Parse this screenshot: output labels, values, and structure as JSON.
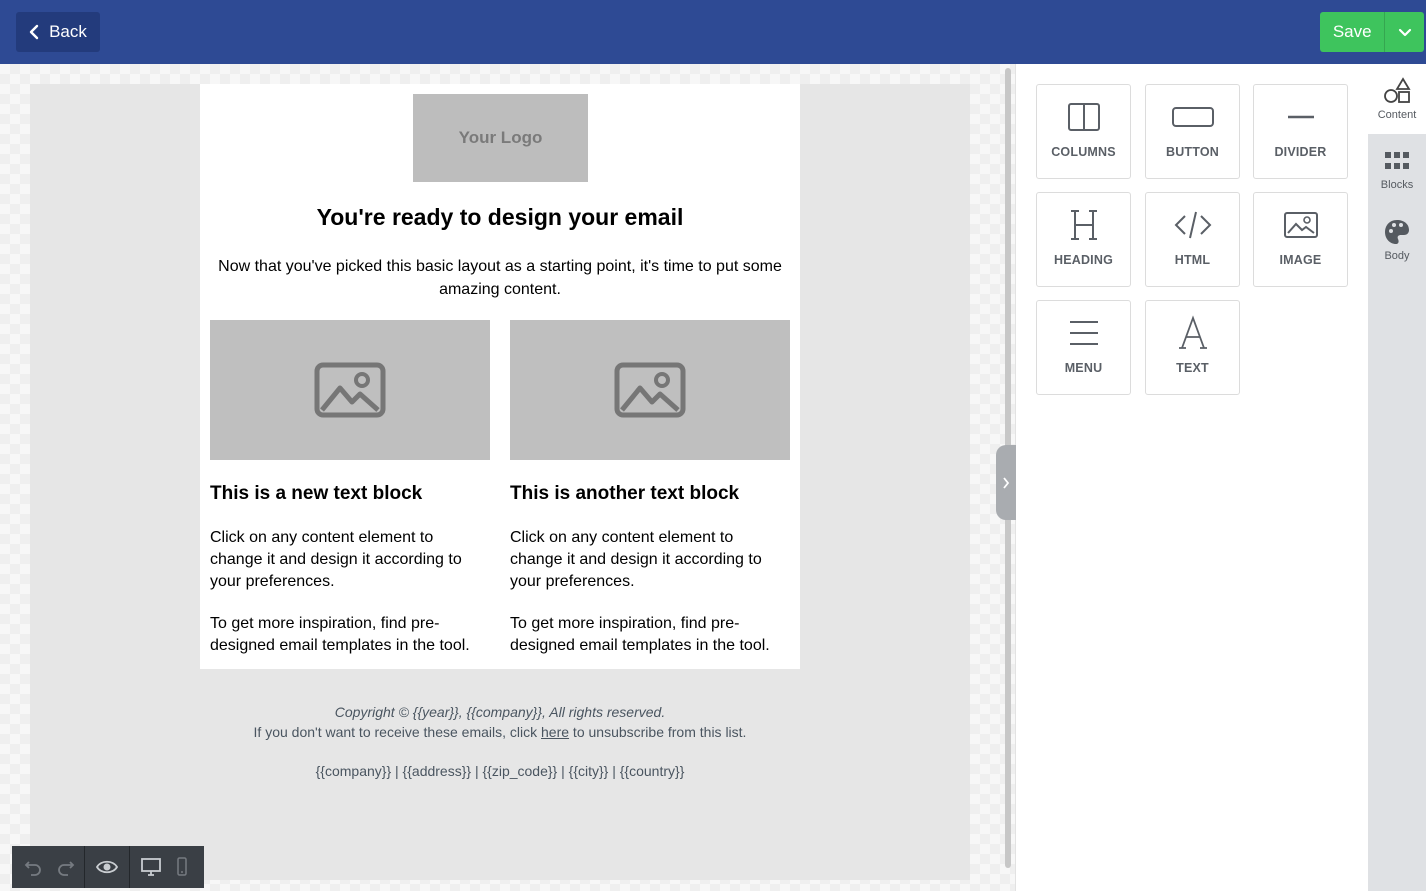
{
  "header": {
    "back_label": "Back",
    "save_label": "Save"
  },
  "email": {
    "logo_text": "Your Logo",
    "title": "You're ready to design your email",
    "intro": "Now that you've picked this basic layout as a starting point, it's time to put some amazing content.",
    "columns": [
      {
        "heading": "This is a new text block",
        "p1": "Click on any content element to change it and design it according to your preferences.",
        "p2": "To get more inspiration, find pre-designed email templates in the tool."
      },
      {
        "heading": "This is another text block",
        "p1": "Click on any content element to change it and design it according to your preferences.",
        "p2": "To get more inspiration, find pre-designed email templates in the tool."
      }
    ],
    "footer": {
      "copyright": "Copyright © {{year}}, {{company}}, All rights reserved.",
      "unsub_before": "If you don't want to receive these emails, click ",
      "unsub_link": "here",
      "unsub_after": " to unsubscribe from this list.",
      "address": "{{company}} | {{address}} | {{zip_code}} | {{city}} | {{country}}"
    }
  },
  "tools": [
    {
      "label": "COLUMNS",
      "icon": "columns-icon"
    },
    {
      "label": "BUTTON",
      "icon": "button-icon"
    },
    {
      "label": "DIVIDER",
      "icon": "divider-icon"
    },
    {
      "label": "HEADING",
      "icon": "heading-icon"
    },
    {
      "label": "HTML",
      "icon": "html-icon"
    },
    {
      "label": "IMAGE",
      "icon": "image-icon"
    },
    {
      "label": "MENU",
      "icon": "menu-icon"
    },
    {
      "label": "TEXT",
      "icon": "text-icon"
    }
  ],
  "side_tabs": [
    {
      "label": "Content",
      "icon": "shapes-icon",
      "active": true
    },
    {
      "label": "Blocks",
      "icon": "grid-icon",
      "active": false
    },
    {
      "label": "Body",
      "icon": "palette-icon",
      "active": false
    }
  ],
  "colors": {
    "header": "#2e4a94",
    "save": "#3ec45d",
    "toolbar": "#3a3f45"
  }
}
